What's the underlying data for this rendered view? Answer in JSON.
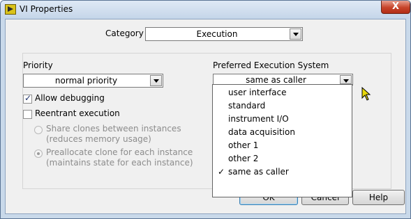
{
  "window": {
    "title": "VI Properties",
    "close_label": "X"
  },
  "category": {
    "label": "Category",
    "value": "Execution"
  },
  "priority": {
    "label": "Priority",
    "value": "normal priority"
  },
  "preferred_execution_system": {
    "label": "Preferred Execution System",
    "value": "same as caller",
    "options": [
      {
        "label": "user interface",
        "selected": false
      },
      {
        "label": "standard",
        "selected": false
      },
      {
        "label": "instrument I/O",
        "selected": false
      },
      {
        "label": "data acquisition",
        "selected": false
      },
      {
        "label": "other 1",
        "selected": false
      },
      {
        "label": "other 2",
        "selected": false
      },
      {
        "label": "same as caller",
        "selected": true
      }
    ],
    "check_mark": "✓"
  },
  "options": {
    "allow_debugging": {
      "label": "Allow debugging",
      "checked": true
    },
    "reentrant_execution": {
      "label": "Reentrant execution",
      "checked": false
    },
    "share_clones": {
      "line1": "Share clones between instances",
      "line2": "(reduces memory usage)",
      "selected": false,
      "enabled": false
    },
    "preallocate_clone": {
      "line1": "Preallocate clone for each instance",
      "line2": "(maintains state for each instance)",
      "selected": true,
      "enabled": false
    }
  },
  "buttons": {
    "ok": "OK",
    "cancel": "Cancel",
    "help": "Help"
  },
  "colors": {
    "titlebar": "#c4d5e9",
    "close_button": "#c7432a",
    "dialog_background": "#f0f0f0",
    "cursor": "#e8d80a"
  }
}
